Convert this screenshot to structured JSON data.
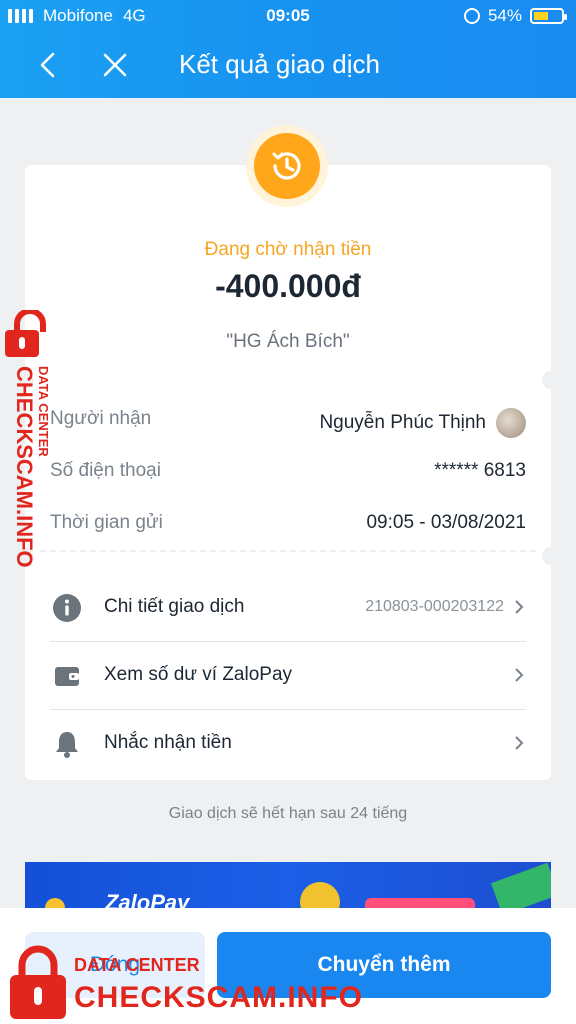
{
  "status_bar": {
    "carrier": "Mobifone",
    "network": "4G",
    "time": "09:05",
    "battery": "54%"
  },
  "nav": {
    "title": "Kết quả giao dịch",
    "back_icon": "chevron-left-icon",
    "close_icon": "close-icon"
  },
  "transaction": {
    "status_text": "Đang chờ nhận tiền",
    "amount": "-400.000đ",
    "message": "\"HG Ách Bích\"",
    "status_icon": "clock-history-icon",
    "details": [
      {
        "label": "Người nhận",
        "value": "Nguyễn Phúc Thịnh"
      },
      {
        "label": "Số điện thoại",
        "value": "****** 6813"
      },
      {
        "label": "Thời gian gửi",
        "value": "09:05 - 03/08/2021"
      }
    ]
  },
  "menu": [
    {
      "label": "Chi tiết giao dịch",
      "sub": "210803-000203122",
      "icon": "info-icon"
    },
    {
      "label": "Xem số dư ví ZaloPay",
      "sub": "",
      "icon": "wallet-icon"
    },
    {
      "label": "Nhắc nhận tiền",
      "sub": "",
      "icon": "bell-icon"
    }
  ],
  "expire_note": "Giao dịch sẽ hết hạn sau 24 tiếng",
  "banner": {
    "logo_text": "ZaloPay"
  },
  "buttons": {
    "close": "Đóng",
    "send_more": "Chuyển thêm"
  },
  "watermark": {
    "line1": "DATA CENTER",
    "line2": "CHECKSCAM.INFO"
  },
  "colors": {
    "header": "#1a90f0",
    "pending": "#f5a623",
    "primary_button": "#1a87f0",
    "watermark": "#e0261d"
  }
}
